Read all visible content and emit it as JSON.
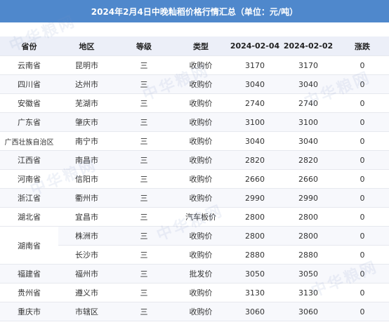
{
  "title": "2024年2月4日中晚籼稻价格行情汇总（单位：元/吨）",
  "watermark": "中华粮网",
  "headers": [
    "省份",
    "地区",
    "等级",
    "类型",
    "2024-02-04",
    "2024-02-02",
    "涨跌"
  ],
  "rows": [
    {
      "province": "云南省",
      "region": "昆明市",
      "grade": "三",
      "type": "收购价",
      "d1": "3170",
      "d2": "3170",
      "change": "0"
    },
    {
      "province": "四川省",
      "region": "达州市",
      "grade": "三",
      "type": "收购价",
      "d1": "3040",
      "d2": "3040",
      "change": "0"
    },
    {
      "province": "安徽省",
      "region": "芜湖市",
      "grade": "三",
      "type": "收购价",
      "d1": "2740",
      "d2": "2740",
      "change": "0"
    },
    {
      "province": "广东省",
      "region": "肇庆市",
      "grade": "三",
      "type": "收购价",
      "d1": "3100",
      "d2": "3100",
      "change": "0"
    },
    {
      "province": "广西壮族自治区",
      "region": "南宁市",
      "grade": "三",
      "type": "收购价",
      "d1": "3040",
      "d2": "3040",
      "change": "0"
    },
    {
      "province": "江西省",
      "region": "南昌市",
      "grade": "三",
      "type": "收购价",
      "d1": "2820",
      "d2": "2820",
      "change": "0"
    },
    {
      "province": "河南省",
      "region": "信阳市",
      "grade": "三",
      "type": "收购价",
      "d1": "2660",
      "d2": "2660",
      "change": "0"
    },
    {
      "province": "浙江省",
      "region": "衢州市",
      "grade": "三",
      "type": "收购价",
      "d1": "2990",
      "d2": "2990",
      "change": "0"
    },
    {
      "province": "湖北省",
      "region": "宜昌市",
      "grade": "三",
      "type": "汽车板价",
      "d1": "2800",
      "d2": "2800",
      "change": "0"
    },
    {
      "province": "湖南省",
      "region": "株洲市",
      "grade": "三",
      "type": "收购价",
      "d1": "2800",
      "d2": "2800",
      "change": "0"
    },
    {
      "province": "",
      "region": "长沙市",
      "grade": "三",
      "type": "收购价",
      "d1": "2880",
      "d2": "2880",
      "change": "0"
    },
    {
      "province": "福建省",
      "region": "福州市",
      "grade": "三",
      "type": "批发价",
      "d1": "3050",
      "d2": "3050",
      "change": "0"
    },
    {
      "province": "贵州省",
      "region": "遵义市",
      "grade": "三",
      "type": "收购价",
      "d1": "3130",
      "d2": "3130",
      "change": "0"
    },
    {
      "province": "重庆市",
      "region": "市辖区",
      "grade": "三",
      "type": "收购价",
      "d1": "3060",
      "d2": "3060",
      "change": "0"
    }
  ]
}
